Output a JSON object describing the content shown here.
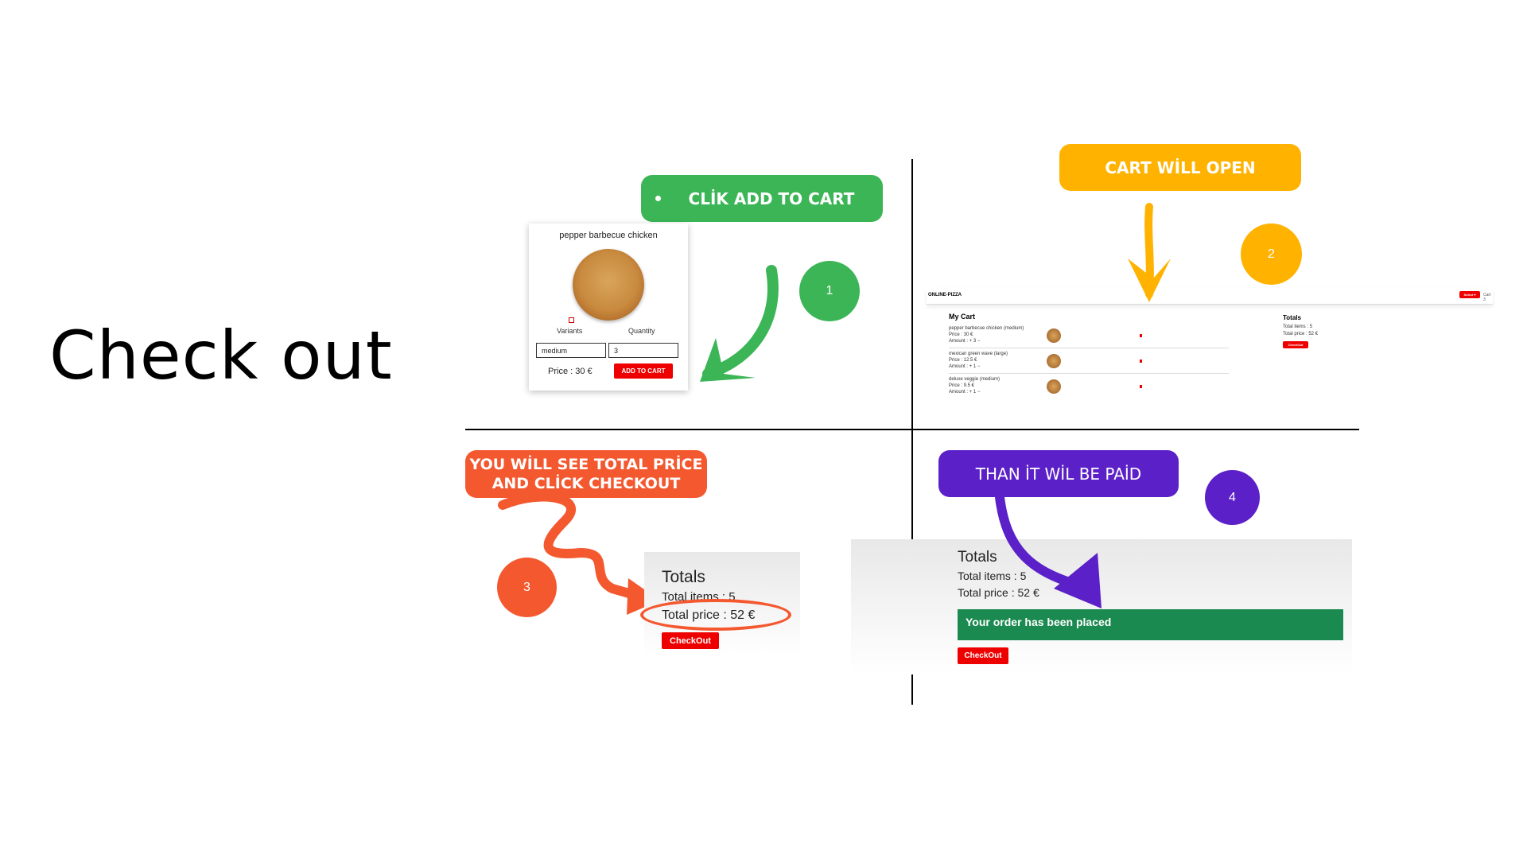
{
  "slide": {
    "title": "Check out"
  },
  "step1": {
    "callout": "CLİK ADD TO CART",
    "number": "1",
    "card": {
      "product_name": "pepper barbecue chicken",
      "variants_label": "Variants",
      "quantity_label": "Quantity",
      "variant_value": "medium",
      "quantity_value": "3",
      "price": "Price : 30 €",
      "add_button": "ADD TO CART"
    }
  },
  "step2": {
    "callout": "CART WİLL OPEN",
    "number": "2",
    "brand": "ONLINE-PIZZA",
    "nav_button": "Select ▾",
    "nav_cart": "Cart 3",
    "cart_title": "My Cart",
    "items": [
      {
        "name": "pepper barbecue chicken (medium)",
        "price": "Price : 30 €",
        "amount": "Amount : + 3 −"
      },
      {
        "name": "mexican green wave (large)",
        "price": "Price : 12.5 €",
        "amount": "Amount : + 1 −"
      },
      {
        "name": "deluxe veggie (medium)",
        "price": "Price : 9.5 €",
        "amount": "Amount : + 1 −"
      }
    ],
    "totals_title": "Totals",
    "total_items": "Total items : 5",
    "total_price": "Total price : 52 €",
    "checkout": "CheckOut"
  },
  "step3": {
    "callout_line1": "YOU WİLL SEE TOTAL PRİCE",
    "callout_line2": "AND CLİCK CHECKOUT",
    "number": "3",
    "totals_title": "Totals",
    "total_items": "Total items : 5",
    "total_price": "Total price : 52 €",
    "checkout": "CheckOut"
  },
  "step4": {
    "callout": "THAN İT WİL BE PAİD",
    "number": "4",
    "totals_title": "Totals",
    "total_items": "Total items : 5",
    "total_price": "Total price : 52 €",
    "success": "Your order has been placed",
    "checkout": "CheckOut"
  },
  "colors": {
    "green": "#3bb556",
    "amber": "#ffb300",
    "orange": "#f4582f",
    "purple": "#5b20c8",
    "red": "#ee0000",
    "success_green": "#1b8a50"
  }
}
